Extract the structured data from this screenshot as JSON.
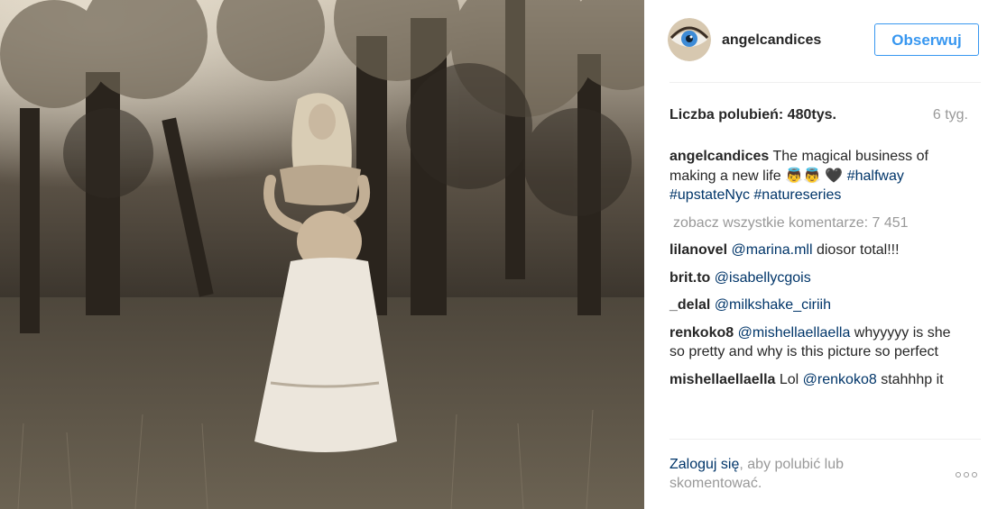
{
  "post": {
    "username": "angelcandices",
    "follow_label": "Obserwuj",
    "likes_text": "Liczba polubień: 480tys.",
    "age_text": "6 tyg.",
    "caption": {
      "username": "angelcandices",
      "text": "The magical business of making a new life 👼👼 🖤",
      "hashtags": [
        "#halfway",
        "#upstateNyc",
        "#natureseries"
      ]
    },
    "view_all_comments": "zobacz wszystkie komentarze: 7 451",
    "comments": [
      {
        "username": "lilanovel",
        "mention": "@marina.mll",
        "text": "diosor total!!!"
      },
      {
        "username": "brit.to",
        "mention": "@isabellycgois",
        "text": ""
      },
      {
        "username": "_delal",
        "mention": "@milkshake_ciriih",
        "text": ""
      },
      {
        "username": "renkoko8",
        "mention": "@mishellaellaella",
        "text": "whyyyyy is she so pretty and why is this picture so perfect"
      },
      {
        "username": "mishellaellaella",
        "pre": "Lol",
        "mention": "@renkoko8",
        "text": "stahhhp it"
      }
    ],
    "login_prompt": {
      "link": "Zaloguj się",
      "text": ", aby polubić lub skomentować."
    },
    "colors": {
      "link": "#003569",
      "follow_blue": "#3897f0",
      "muted": "#999999",
      "photo_tone": "sepia"
    },
    "icons": [
      "avatar-eye-icon",
      "more-options-icon"
    ]
  }
}
